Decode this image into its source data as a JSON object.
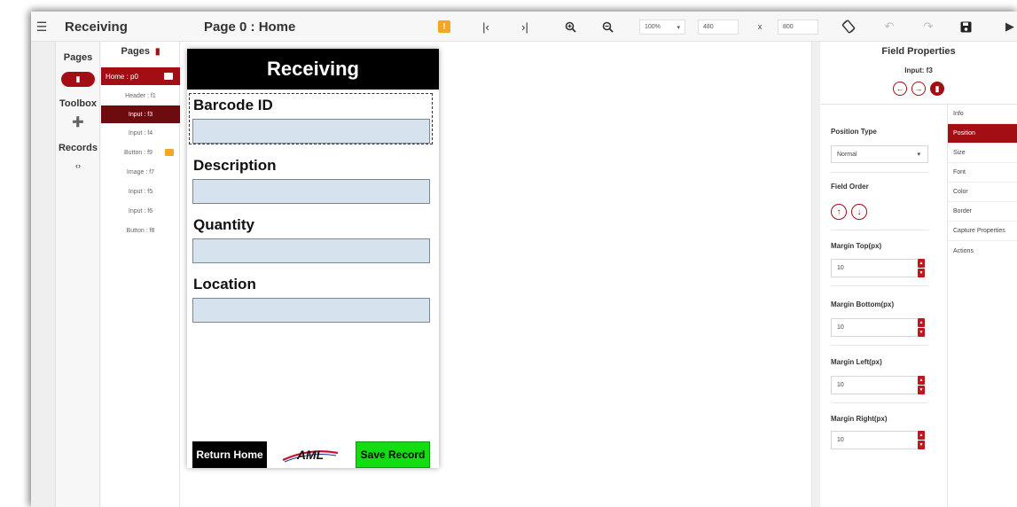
{
  "app": {
    "title": "Receiving",
    "menu_icon": "hamburger-icon"
  },
  "toolbar": {
    "page_title": "Page 0 : Home",
    "warning_glyph": "!",
    "zoom": "100%",
    "width": "480",
    "x_label": "x",
    "height": "800"
  },
  "nav": {
    "pages_label": "Pages",
    "toolbox_label": "Toolbox",
    "records_label": "Records"
  },
  "page_list": {
    "header": "Pages",
    "home": "Home : p0",
    "items": [
      "Header : f1",
      "Input : f3",
      "Input : f4",
      "Button : f9",
      "Image : f7",
      "Input : f5",
      "Input : f6",
      "Button : f8"
    ]
  },
  "form": {
    "header": "Receiving",
    "fields": [
      "Barcode ID",
      "Description",
      "Quantity",
      "Location"
    ],
    "return_button": "Return Home",
    "save_button": "Save Record",
    "logo_text": "AML",
    "colors": {
      "header_bg": "#000000",
      "input_bg": "#d6e2ee",
      "save_bg": "#11dd11"
    }
  },
  "properties": {
    "title": "Field Properties",
    "subtitle": "Input: f3",
    "position_type_label": "Position Type",
    "position_type_value": "Normal",
    "field_order_label": "Field Order",
    "margins": [
      {
        "label": "Margin Top(px)",
        "value": "10"
      },
      {
        "label": "Margin Bottom(px)",
        "value": "10"
      },
      {
        "label": "Margin Left(px)",
        "value": "10"
      },
      {
        "label": "Margin Right(px)",
        "value": "10"
      }
    ],
    "tabs": [
      "Info",
      "Position",
      "Size",
      "Font",
      "Color",
      "Border",
      "Capture Properties",
      "Actions"
    ],
    "active_tab": "Position",
    "accent": "#a30d14"
  }
}
